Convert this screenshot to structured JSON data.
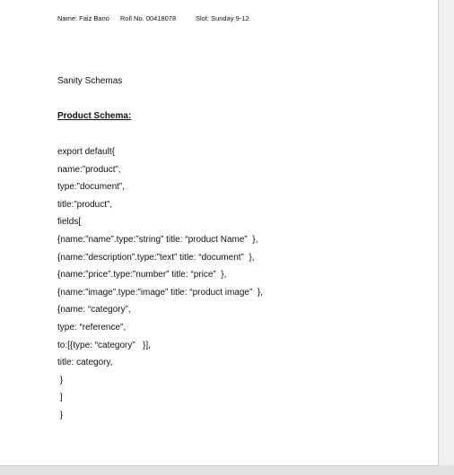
{
  "header": {
    "name": "Name: Faiz Bano",
    "roll": "Roll No. 00418078",
    "slot": "Slot:  Sunday 9-12"
  },
  "doc": {
    "title": "Sanity Schemas",
    "heading": "Product Schema:"
  },
  "code_lines": [
    "export default{",
    "name:”product”,",
    "type:”document”,",
    "title:”product”,",
    "fields[",
    "{name:”name”.type:”string” title: “product Name”  },",
    "{name:”description”.type:”text” title: “document”  },",
    "{name:”price”.type:”number” title: “price”  },",
    "{name:”image”.type:”image” title: “product image”  },",
    "{name: “category”,",
    "type: “reference”,",
    "to:[{type: “category”   }],",
    "title: category,",
    " }",
    " ]",
    " }"
  ]
}
